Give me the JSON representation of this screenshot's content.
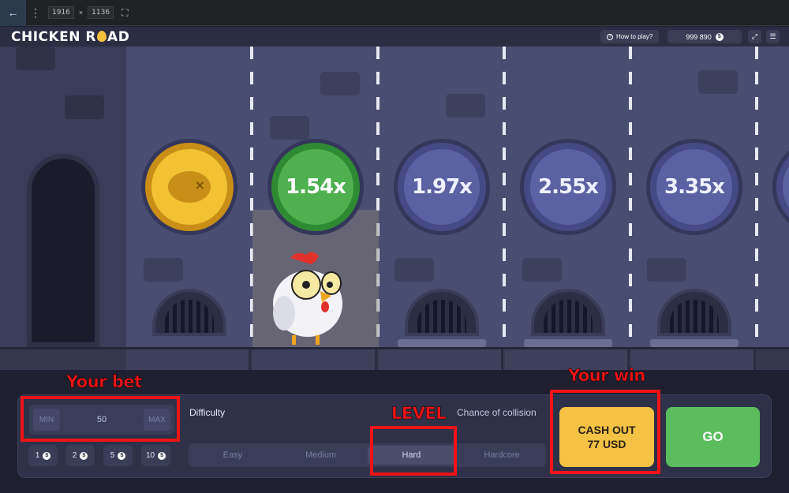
{
  "devtools": {
    "back_icon": "arrow-left-icon",
    "menu_icon": "kebab-icon",
    "width": "1916",
    "times": "×",
    "height": "1136",
    "fullscreen_icon": "fullscreen-icon"
  },
  "header": {
    "logo_left": "CHICKEN R",
    "logo_right": "AD",
    "how_to_play": "How to play?",
    "balance": "999 890",
    "coin_symbol": "$"
  },
  "lanes": {
    "multipliers": [
      "1.54x",
      "1.97x",
      "2.55x",
      "3.35x"
    ]
  },
  "controls": {
    "bet": {
      "min": "MIN",
      "value": "50",
      "max": "MAX"
    },
    "chips": [
      "1",
      "2",
      "5",
      "10"
    ],
    "difficulty_label": "Difficulty",
    "chance_label": "Chance of collision",
    "difficulties": [
      "Easy",
      "Medium",
      "Hard",
      "Hardcore"
    ],
    "selected_difficulty": "Hard",
    "cashout_line1": "CASH OUT",
    "cashout_line2": "77 USD",
    "go_label": "GO"
  },
  "annotations": {
    "bet": "Your bet",
    "level": "LEVEL",
    "win": "Your win",
    "color": "#f01318"
  }
}
